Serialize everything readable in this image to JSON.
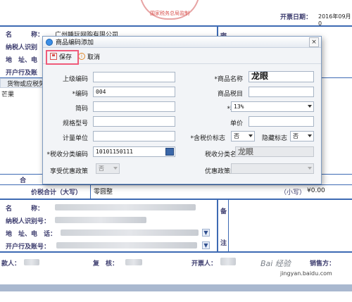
{
  "invoice": {
    "seal_text": "国家税务总局监制",
    "date_label": "开票日期：",
    "date_value": "2016年09月0",
    "buyer": {
      "name_label": "名",
      "name_colon": "称：",
      "name_value": "广州睡玩网购有限公司",
      "taxid_label": "纳税人识别",
      "address_label": "地　址、电",
      "bank_label": "开户行及账",
      "side_label": "密"
    },
    "goods_header": "货物或应税劳",
    "row1_item": "芒果",
    "total_label": "合",
    "price_tax_label": "价税合计（大写）",
    "price_tax_upper": "零圆整",
    "price_tax_lower_label": "（小写）",
    "price_tax_lower_value": "¥0.00",
    "seller": {
      "name_label": "名　　　称：",
      "taxid_label": "纳税人识别号：",
      "address_label": "地　址、电　话：",
      "bank_label": "开户行及账号：",
      "side_label1": "备",
      "side_label2": "注"
    },
    "payee_label": "款人：",
    "reviewer_label": "复　核：",
    "drawer_label": "开票人：",
    "seller_sign_label": "销售方：",
    "pick_icon": "▼"
  },
  "dialog": {
    "title": "商品编码添加",
    "close_glyph": "×",
    "toolbar": {
      "save_label": "保存",
      "cancel_label": "取消"
    },
    "fields": {
      "parent_code_label": "上级编码",
      "parent_code_value": "",
      "code_label": "*编码",
      "code_value": "004",
      "short_code_label": "简码",
      "short_code_value": "",
      "spec_label": "规格型号",
      "spec_value": "",
      "unit_label": "计量单位",
      "unit_value": "",
      "tax_class_code_label": "*税收分类编码",
      "tax_class_code_value": "10101150111",
      "preferential_label": "享受优惠政策",
      "preferential_value": "否",
      "product_name_label": "*商品名称",
      "product_name_value": "龙眼",
      "product_tax_item_label": "商品税目",
      "product_tax_item_value": "",
      "tax_rate_label": "*税率",
      "tax_rate_value": "13%",
      "unit_price_label": "单价",
      "unit_price_value": "",
      "tax_included_label": "*含税价标志",
      "tax_included_value": "否",
      "hide_flag_label": "隐藏标志",
      "hide_flag_value": "否",
      "tax_class_name_label": "税收分类名称",
      "tax_class_name_value": "龙眼",
      "policy_type_label": "优惠政策类型",
      "policy_type_value": ""
    }
  },
  "watermark": {
    "line1": "Bai 经验",
    "line2": "jingyan.baidu.com"
  },
  "colors": {
    "accent": "#3d6ab3",
    "highlight": "#ef5b7a",
    "seal": "#d9534f"
  }
}
